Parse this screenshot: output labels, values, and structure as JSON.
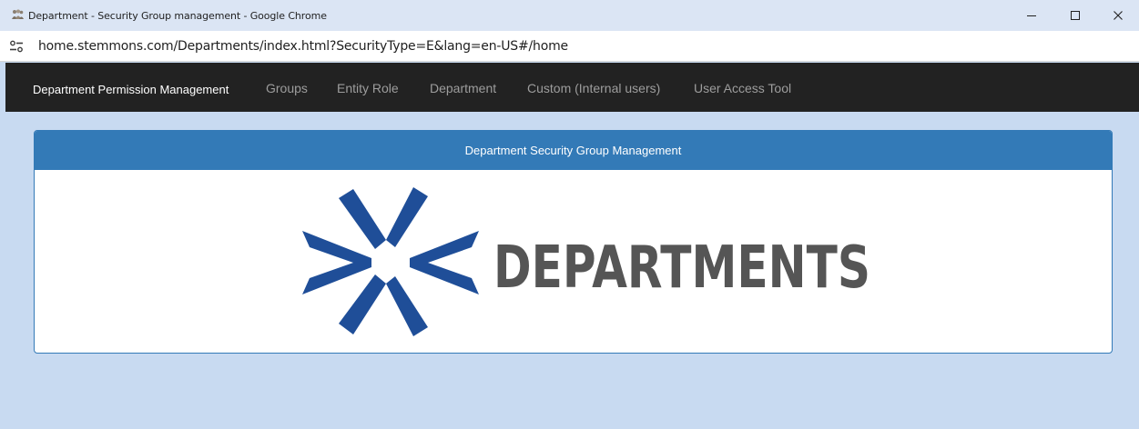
{
  "window": {
    "title": "Department - Security Group management - Google Chrome",
    "controls": {
      "minimize": "–",
      "maximize": "☐",
      "close": "✕"
    }
  },
  "address_bar": {
    "url": "home.stemmons.com/Departments/index.html?SecurityType=E&lang=en-US#/home"
  },
  "navbar": {
    "brand": "Department Permission Management",
    "links": [
      "Groups",
      "Entity Role",
      "Department",
      "Custom (Internal users)",
      "User Access Tool"
    ]
  },
  "panel": {
    "heading": "Department Security Group Management",
    "logo_text": "DEPARTMENTS"
  },
  "colors": {
    "page_bg": "#c8daf1",
    "navbar_bg": "#222222",
    "panel_heading": "#337ab7",
    "logo_blue": "#1f4e98",
    "logo_gray": "#555555"
  }
}
